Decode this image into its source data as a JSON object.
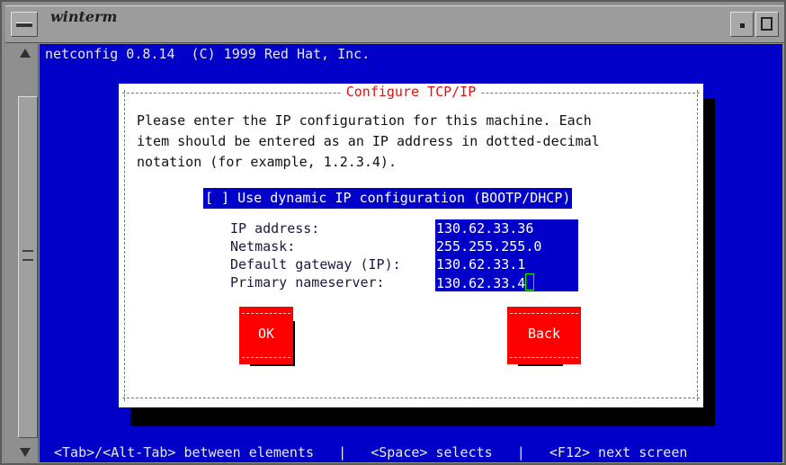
{
  "window": {
    "title": "winterm"
  },
  "terminal": {
    "header_line": "netconfig 0.8.14  (C) 1999 Red Hat, Inc.",
    "status_line": "<Tab>/<Alt-Tab> between elements   |   <Space> selects   |   <F12> next screen"
  },
  "dialog": {
    "title": "Configure TCP/IP",
    "description": "Please enter the IP configuration for this machine. Each\nitem should be entered as an IP address in dotted-decimal\nnotation (for example, 1.2.3.4).",
    "dhcp_checkbox": {
      "label": "[ ] Use dynamic IP configuration (BOOTP/DHCP)",
      "checked": false
    },
    "fields": [
      {
        "label": "IP address:",
        "value": "130.62.33.36"
      },
      {
        "label": "Netmask:",
        "value": "255.255.255.0"
      },
      {
        "label": "Default gateway (IP):",
        "value": "130.62.33.1"
      },
      {
        "label": "Primary nameserver:",
        "value": "130.62.33.4"
      }
    ],
    "buttons": {
      "ok": "OK",
      "back": "Back"
    }
  },
  "colors": {
    "terminal_bg": "#0000c8",
    "dialog_bg": "#ffffff",
    "dialog_title": "#e01010",
    "button_bg": "#ff0000",
    "cursor": "#00ff00"
  },
  "icons": {
    "window_menu": "window-menu-icon",
    "minimize": "minimize-icon",
    "maximize": "maximize-icon",
    "scroll_up": "arrow-up-icon",
    "scroll_down": "arrow-down-icon"
  }
}
